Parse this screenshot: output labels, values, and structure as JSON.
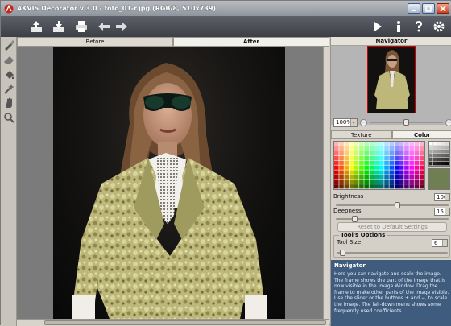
{
  "window": {
    "title": "AKVIS Decorator v.3.0 - foto_01-r.jpg (RGB/8, 510x739)"
  },
  "toolbar": {
    "icons": [
      "open-icon",
      "save-icon",
      "print-icon",
      "undo-icon",
      "redo-icon",
      "run-icon",
      "info-icon",
      "help-icon",
      "settings-icon"
    ]
  },
  "left_tools": [
    "brush-icon",
    "eraser-icon",
    "fill-icon",
    "magic-wand-icon",
    "hand-icon",
    "zoom-icon"
  ],
  "view_tabs": {
    "before": "Before",
    "after": "After",
    "active": "After"
  },
  "navigator": {
    "title": "Navigator",
    "zoom": "100%",
    "minus": "−",
    "plus": "+",
    "zoom_slider_pos": 0.5
  },
  "texture_tabs": {
    "texture": "Texture",
    "color": "Color",
    "active": "Color"
  },
  "params": {
    "brightness_label": "Brightness",
    "brightness_value": "100",
    "brightness_slider_pos": 0.55,
    "deepness_label": "Deepness",
    "deepness_value": "15",
    "deepness_slider_pos": 0.15,
    "reset_label": "Reset to Default Settings"
  },
  "tool_options": {
    "title": "Tool's Options",
    "tool_size_label": "Tool Size",
    "tool_size_value": "6",
    "tool_size_slider_pos": 0.03
  },
  "help": {
    "title": "Navigator",
    "body": "Here you can navigate and scale the image. The frame shows the part of the image that is now visible in the Image Window. Drag the frame to make other parts of the image visible. Use the slider or the buttons + and −, to scale the image. The fall-down menu shows some frequently used coefficients."
  },
  "colors": {
    "selected_swatch": "#6f7f52",
    "help_bg": "#3f5c7e"
  }
}
